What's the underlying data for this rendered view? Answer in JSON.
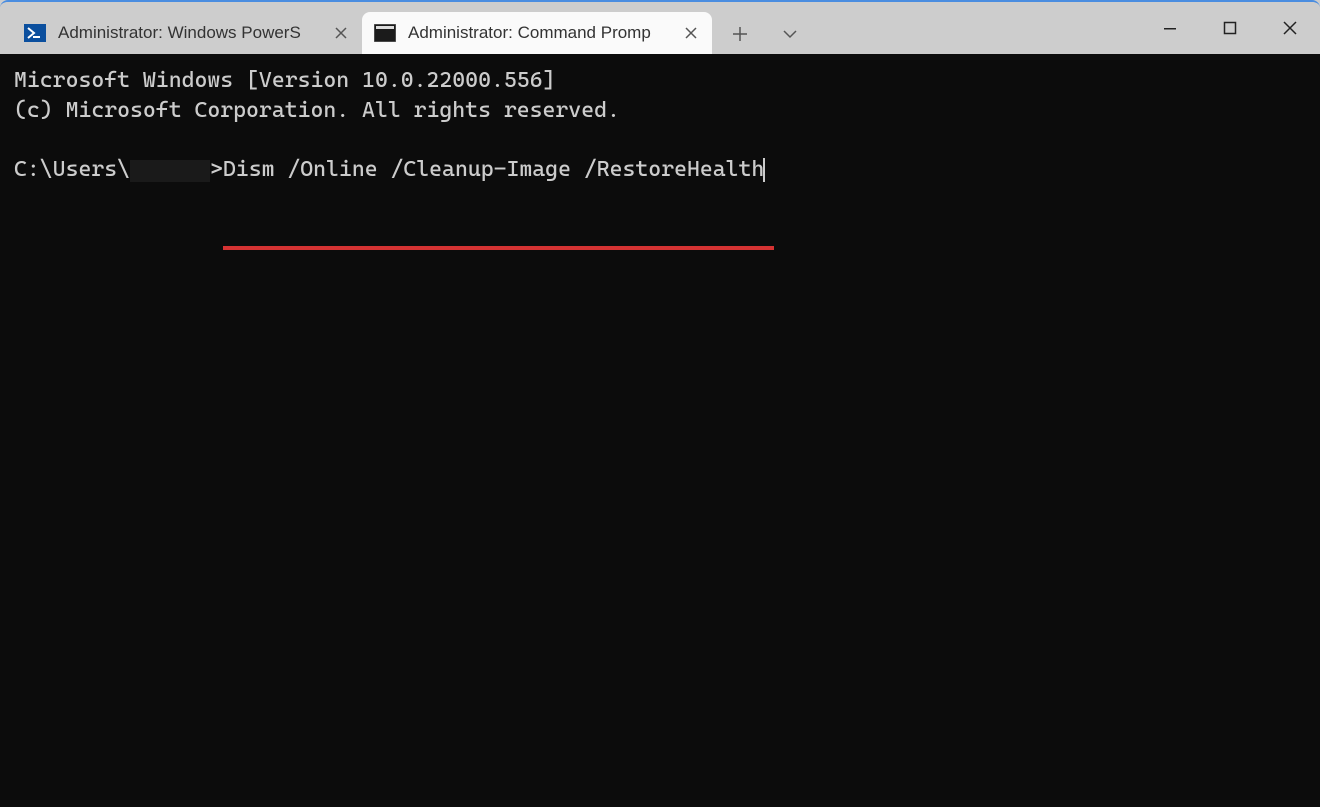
{
  "tabs": [
    {
      "label": "Administrator: Windows PowerS",
      "icon": "powershell-icon",
      "active": false
    },
    {
      "label": "Administrator: Command Promp",
      "icon": "cmd-icon",
      "active": true
    }
  ],
  "terminal": {
    "banner_line1": "Microsoft Windows [Version 10.0.22000.556]",
    "banner_line2": "(c) Microsoft Corporation. All rights reserved.",
    "prompt_prefix": "C:\\Users\\",
    "prompt_suffix": ">",
    "command": "Dism /Online /Cleanup-Image /RestoreHealth"
  },
  "annotation": {
    "underline_color": "#d63333"
  }
}
